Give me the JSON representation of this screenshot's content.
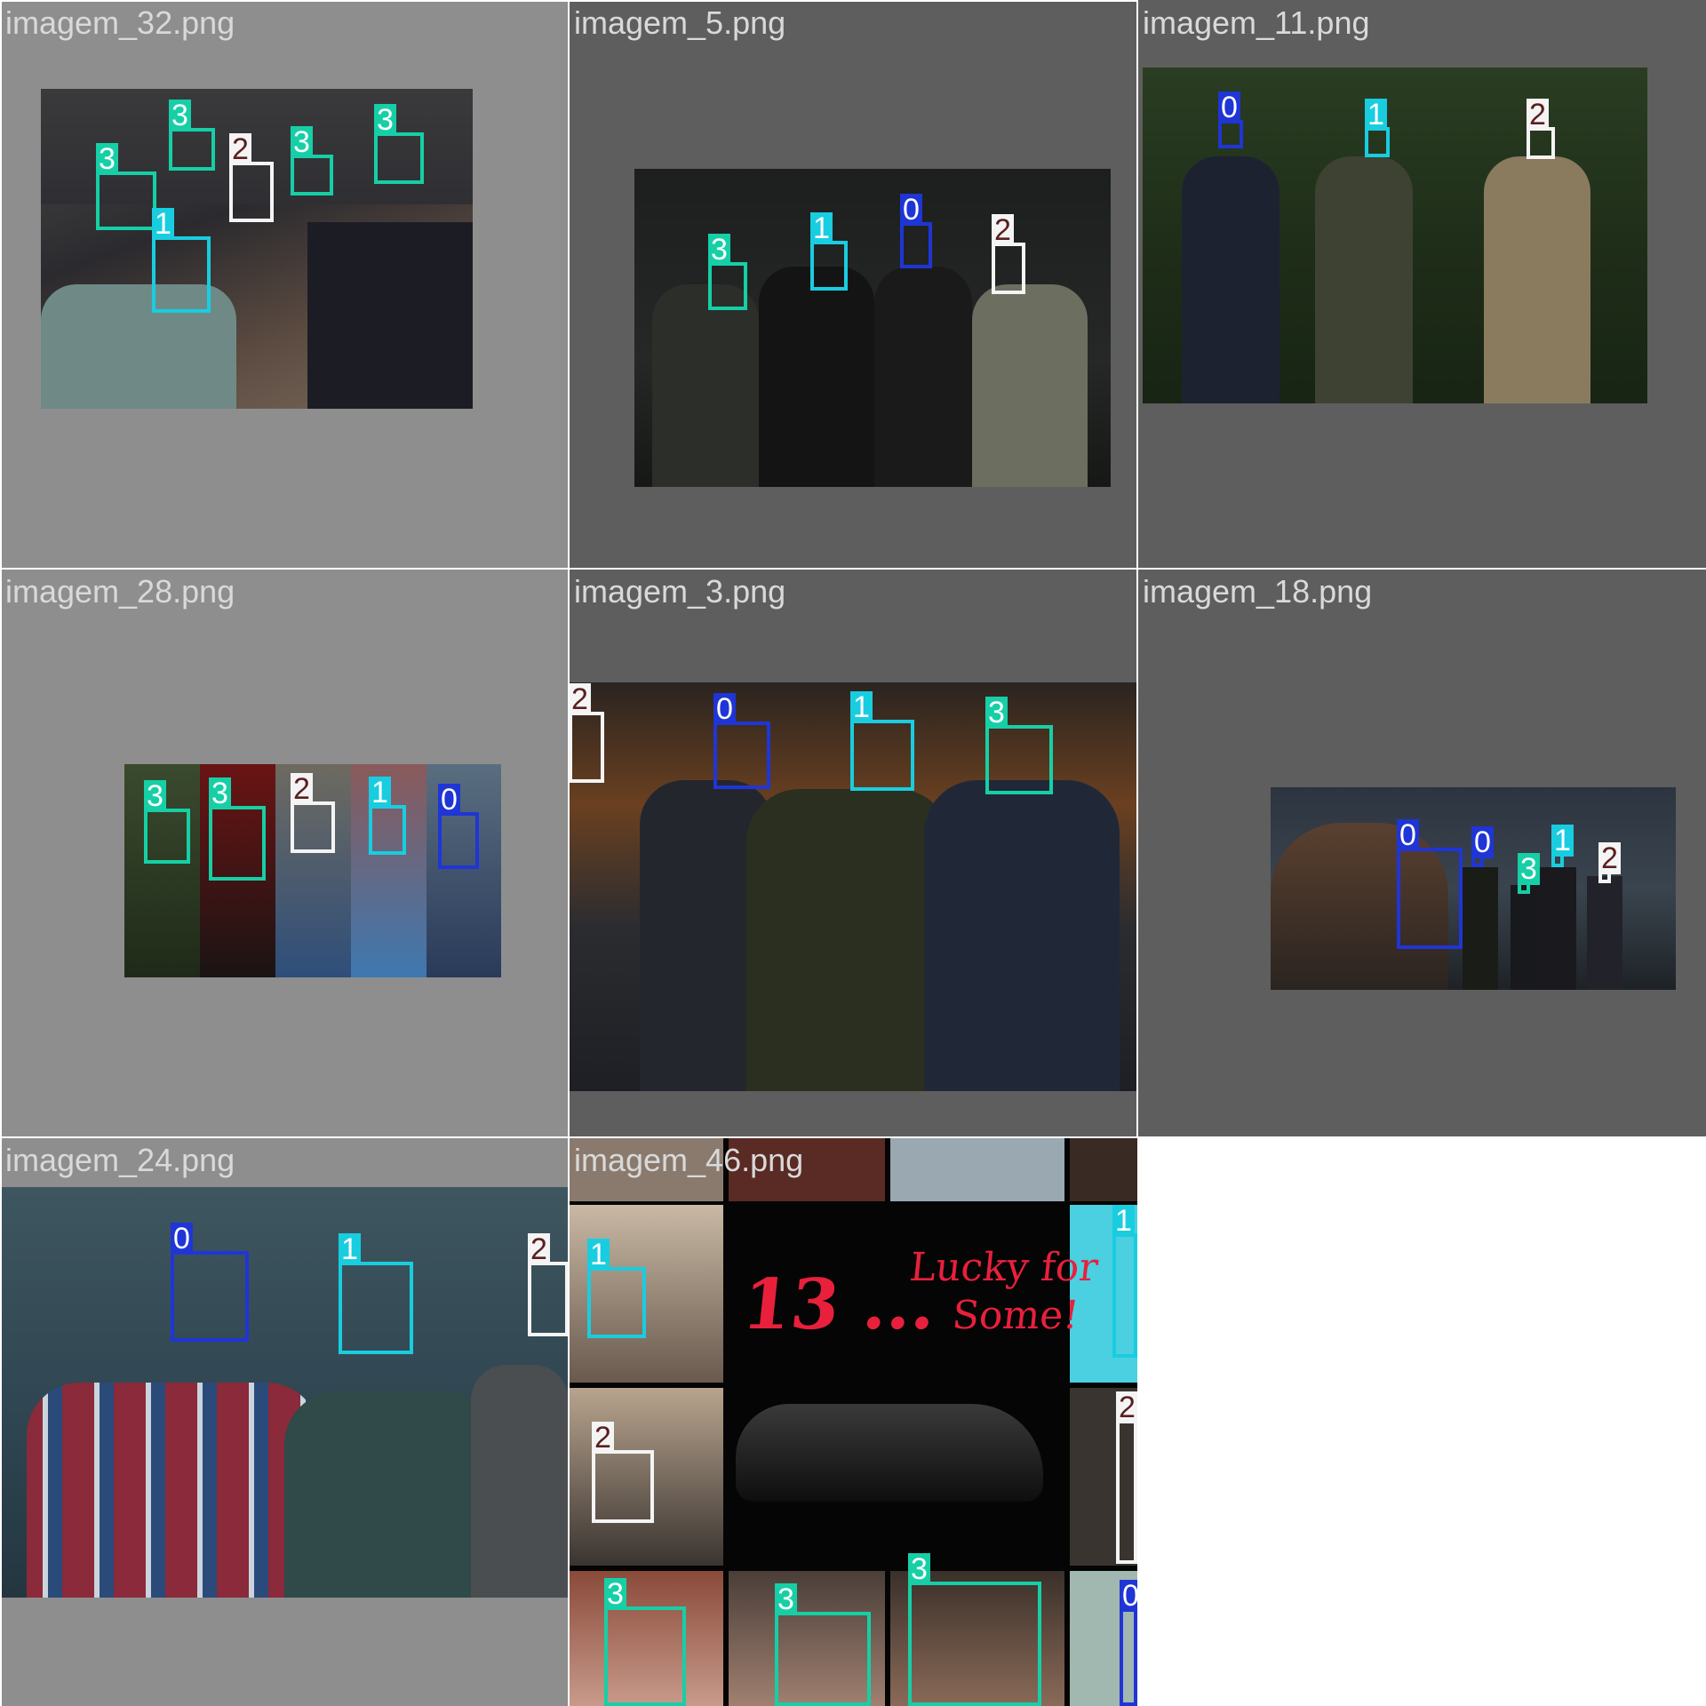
{
  "tiles": [
    {
      "filename": "imagem_32.png",
      "labels": [
        "3",
        "3",
        "2",
        "3",
        "3",
        "1"
      ]
    },
    {
      "filename": "imagem_5.png",
      "labels": [
        "3",
        "1",
        "0",
        "2"
      ]
    },
    {
      "filename": "imagem_11.png",
      "labels": [
        "0",
        "1",
        "2"
      ]
    },
    {
      "filename": "imagem_28.png",
      "labels": [
        "3",
        "3",
        "2",
        "1",
        "0"
      ]
    },
    {
      "filename": "imagem_3.png",
      "labels": [
        "2",
        "0",
        "1",
        "3"
      ]
    },
    {
      "filename": "imagem_18.png",
      "labels": [
        "0",
        "0",
        "3",
        "1",
        "2"
      ]
    },
    {
      "filename": "imagem_24.png",
      "labels": [
        "0",
        "1",
        "2"
      ]
    },
    {
      "filename": "imagem_46.png",
      "labels": [
        "1",
        "1",
        "2",
        "2",
        "3",
        "3",
        "3",
        "0"
      ],
      "poster_line1": "13 ...",
      "poster_line2": "Lucky for",
      "poster_line3": "Some!"
    }
  ],
  "colors": {
    "class_0": "#1f35d6",
    "class_1": "#19cde0",
    "class_2": "#f4f4f4",
    "class_3": "#16cfa6",
    "tile_light": "#8e8e8e",
    "tile_dark": "#5e5e5e"
  }
}
